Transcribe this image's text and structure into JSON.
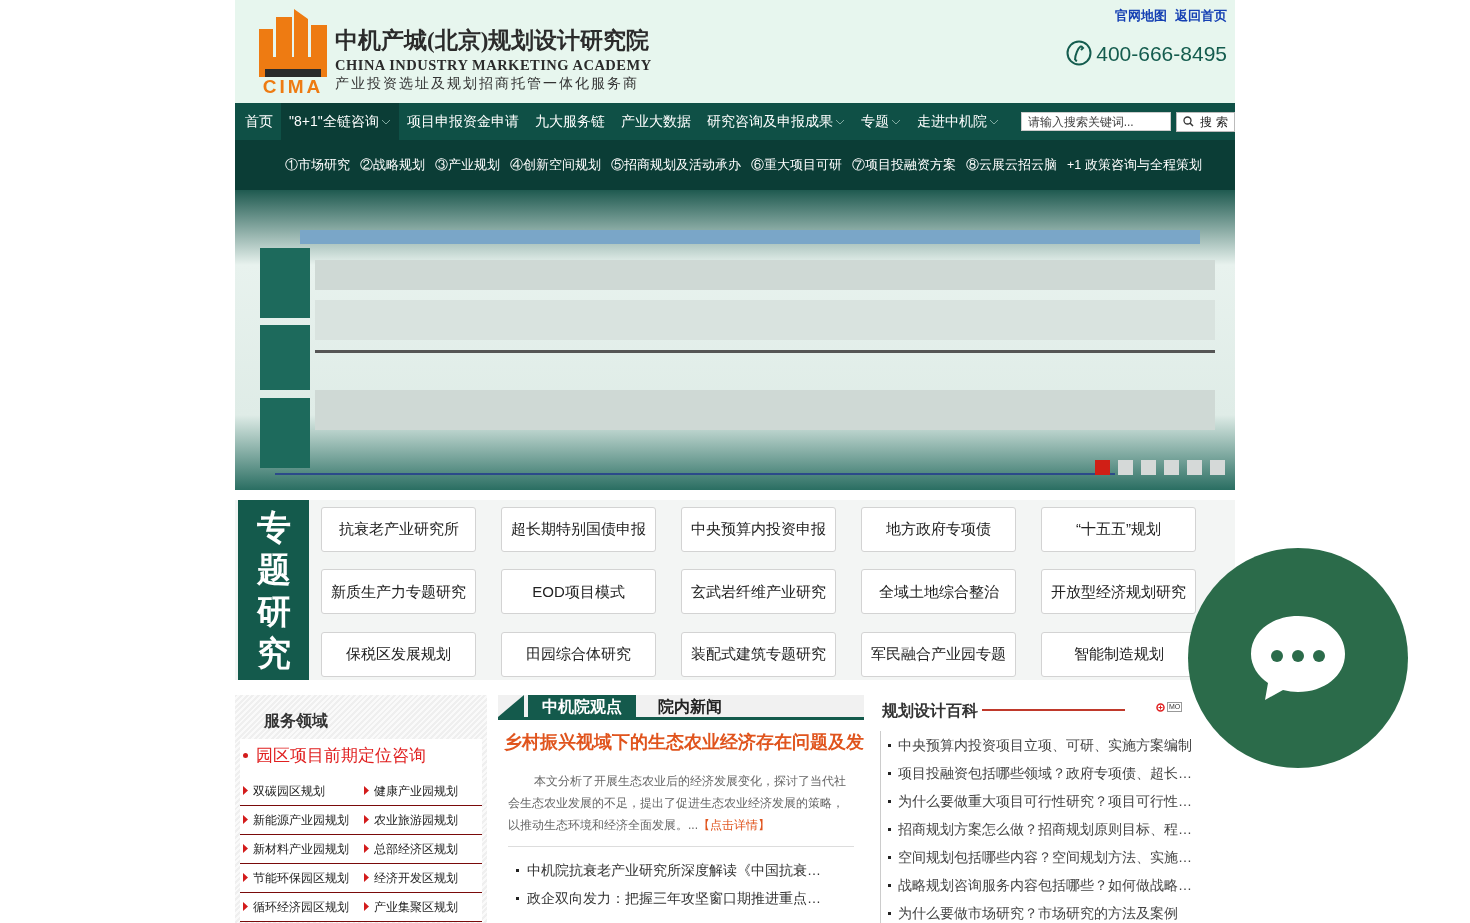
{
  "header": {
    "logo_letters": "CIMA",
    "org_name": "中机产城(北京)规划设计研究院",
    "org_name_en": "CHINA INDUSTRY MARKETING ACADEMY",
    "tagline": "产业投资选址及规划招商托管一体化服务商",
    "top_links": [
      "官网地图",
      "返回首页"
    ],
    "phone": "400-666-8495"
  },
  "nav": {
    "items": [
      {
        "label": "首页",
        "selected": false,
        "dropdown": false
      },
      {
        "label": "\"8+1\"全链咨询",
        "selected": true,
        "dropdown": true
      },
      {
        "label": "项目申报资金申请",
        "selected": false,
        "dropdown": false
      },
      {
        "label": "九大服务链",
        "selected": false,
        "dropdown": false
      },
      {
        "label": "产业大数据",
        "selected": false,
        "dropdown": false
      },
      {
        "label": "研究咨询及申报成果",
        "selected": false,
        "dropdown": true
      },
      {
        "label": "专题",
        "selected": false,
        "dropdown": true
      },
      {
        "label": "走进中机院",
        "selected": false,
        "dropdown": true
      }
    ],
    "search": {
      "placeholder": "请输入搜索关键词...",
      "button": "搜 索"
    },
    "submenu": [
      "①市场研究",
      "②战略规划",
      "③产业规划",
      "④创新空间规划",
      "⑤招商规划及活动承办",
      "⑥重大项目可研",
      "⑦项目投融资方案",
      "⑧云展云招云脑",
      "+1 政策咨询与全程策划"
    ]
  },
  "banner": {
    "kind": "picture",
    "dots": [
      {
        "selected": true
      },
      {
        "selected": false
      },
      {
        "selected": false
      },
      {
        "selected": false
      },
      {
        "selected": false
      },
      {
        "selected": false
      }
    ]
  },
  "topics": {
    "title": "专题研究",
    "items": [
      "抗衰老产业研究所",
      "超长期特别国债申报",
      "中央预算内投资申报",
      "地方政府专项债",
      "“十五五”规划",
      "新质生产力专题研究",
      "EOD项目模式",
      "玄武岩纤维产业研究",
      "全域土地综合整治",
      "开放型经济规划研究",
      "保税区发展规划",
      "田园综合体研究",
      "装配式建筑专题研究",
      "军民融合产业园专题",
      "智能制造规划"
    ]
  },
  "services": {
    "title": "服务领域",
    "headline": "园区项目前期定位咨询",
    "items": [
      "双碳园区规划",
      "健康产业园规划",
      "新能源产业园规划",
      "农业旅游园规划",
      "新材料产业园规划",
      "总部经济区规划",
      "节能环保园区规划",
      "经济开发区规划",
      "循环经济园区规划",
      "产业集聚区规划"
    ]
  },
  "news": {
    "tabs": [
      {
        "label": "中机院观点",
        "selected": true
      },
      {
        "label": "院内新闻",
        "selected": false
      }
    ],
    "headline": "乡村振兴视域下的生态农业经济存在问题及发",
    "summary": "本文分析了开展生态农业后的经济发展变化，探讨了当代社会生态农业发展的不足，提出了促进生态农业经济发展的策略，以推动生态环境和经济全面发展。...",
    "detail_link": "【点击详情】",
    "items": [
      "中机院抗衰老产业研究所深度解读《中国抗衰…",
      "政企双向发力：把握三年攻坚窗口期推进重点…"
    ]
  },
  "wiki": {
    "title": "规划设计百科",
    "more": "MO",
    "items": [
      "中央预算内投资项目立项、可研、实施方案编制",
      "项目投融资包括哪些领域？政府专项债、超长…",
      "为什么要做重大项目可行性研究？项目可行性…",
      "招商规划方案怎么做？招商规划原则目标、程…",
      "空间规划包括哪些内容？空间规划方法、实施…",
      "战略规划咨询服务内容包括哪些？如何做战略…",
      "为什么要做市场研究？市场研究的方法及案例"
    ]
  }
}
